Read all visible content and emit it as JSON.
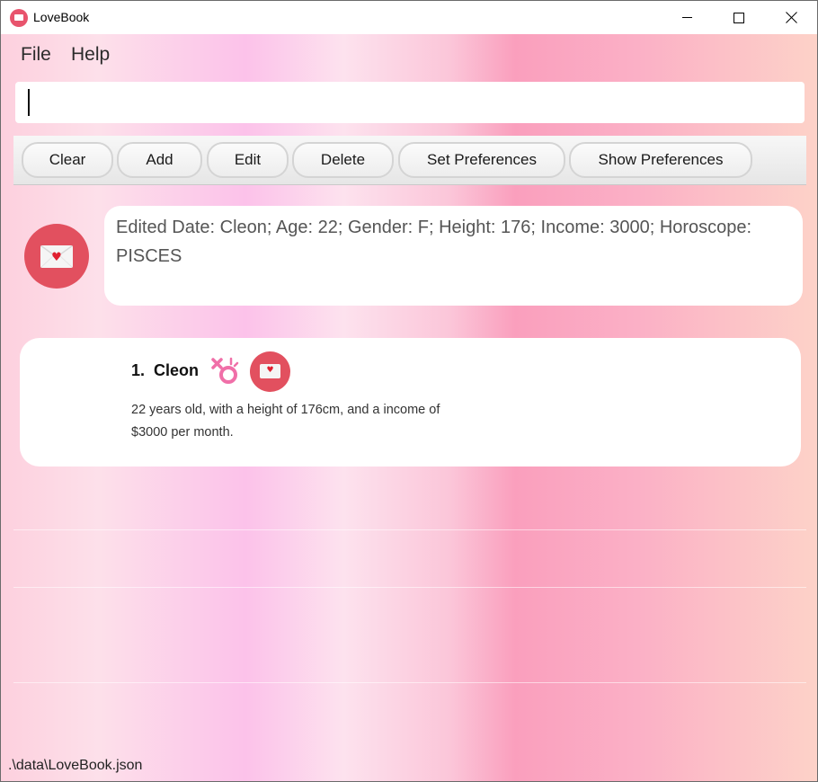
{
  "window": {
    "title": "LoveBook"
  },
  "menu": {
    "file": "File",
    "help": "Help"
  },
  "command": {
    "value": ""
  },
  "toolbar": {
    "clear": "Clear",
    "add": "Add",
    "edit": "Edit",
    "delete": "Delete",
    "set_preferences": "Set Preferences",
    "show_preferences": "Show Preferences"
  },
  "result": {
    "icon": "envelope-heart-icon",
    "text": "Edited Date: Cleon; Age: 22; Gender: F; Height: 176; Income: 3000; Horoscope: PISCES"
  },
  "dates": [
    {
      "index": "1.",
      "name": "Cleon",
      "gender_icon": "female-gender-icon",
      "description_line1": "22 years old, with a height of 176cm, and a income of",
      "description_line2": "$3000 per month."
    }
  ],
  "status": {
    "file_path": ".\\data\\LoveBook.json"
  },
  "colors": {
    "accent": "#e2505f",
    "heart": "#e02030",
    "gender_icon": "#f06fa8"
  }
}
